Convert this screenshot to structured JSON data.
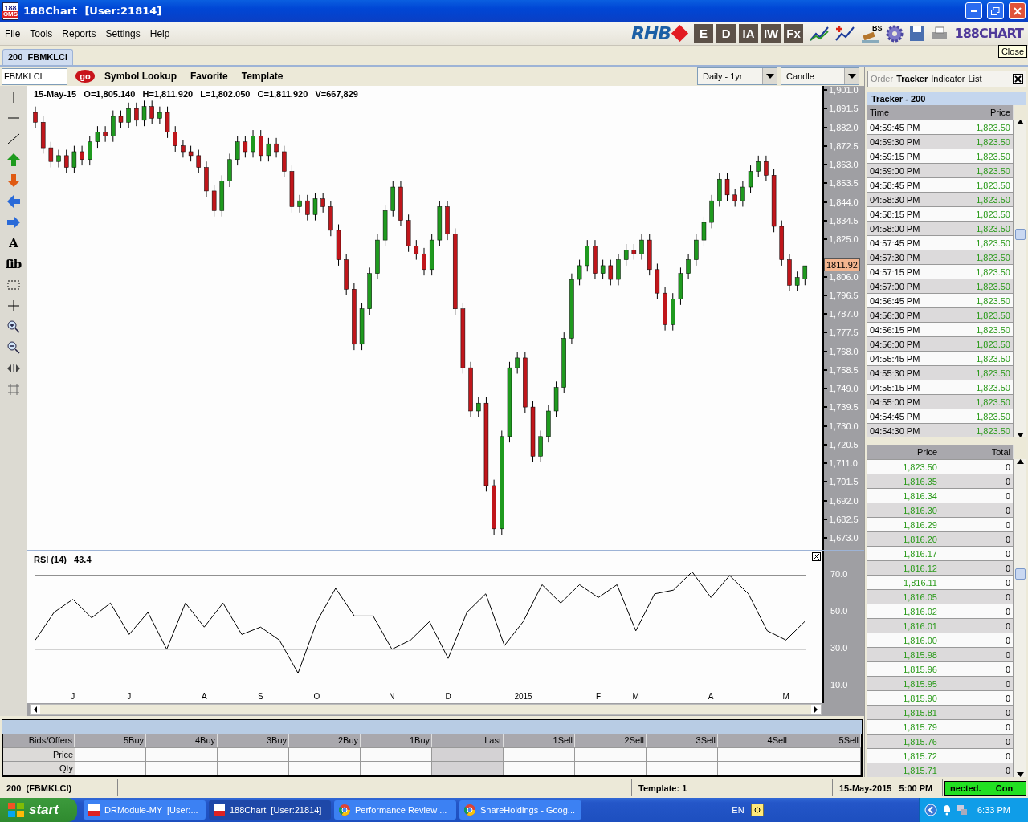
{
  "window": {
    "icon_text": "188",
    "icon_subtext": "OMS",
    "title": "188Chart  [User:21814]"
  },
  "menu": [
    "File",
    "Tools",
    "Reports",
    "Settings",
    "Help"
  ],
  "toolbar": {
    "logo": "RHB",
    "buttons": [
      {
        "label": "E"
      },
      {
        "label": "D"
      },
      {
        "label": "IA"
      },
      {
        "label": "IW"
      },
      {
        "label": "Fx"
      }
    ],
    "gavel_text": "BS",
    "brand": "188CHART",
    "tooltip": "Close"
  },
  "doc_tab": {
    "label": "200  FBMKLCI",
    "selected": true
  },
  "chart_toolbar": {
    "symbol": "FBMKLCI",
    "go": "go",
    "links": [
      "Symbol Lookup",
      "Favorite",
      "Template"
    ],
    "period": "Daily - 1yr",
    "style": "Candle"
  },
  "tools": [
    {
      "kind": "vline"
    },
    {
      "kind": "hline"
    },
    {
      "kind": "trend"
    },
    {
      "kind": "up"
    },
    {
      "kind": "down"
    },
    {
      "kind": "left"
    },
    {
      "kind": "right"
    },
    {
      "kind": "text",
      "label": "A"
    },
    {
      "kind": "text",
      "label": "fib"
    },
    {
      "kind": "select"
    },
    {
      "kind": "cross"
    },
    {
      "kind": "zoomin"
    },
    {
      "kind": "zoomout"
    },
    {
      "kind": "pan"
    },
    {
      "kind": "grid"
    }
  ],
  "chart": {
    "header": "15-May-15   O=1,805.140   H=1,811.920   L=1,802.050   C=1,811.920   V=667,829",
    "last_price_tag": "1811.92",
    "chart_data": {
      "type": "candlestick",
      "ylim": [
        1667.3,
        1903.5
      ],
      "yticks": [
        {
          "value": 1901,
          "label": "1,901.0"
        },
        {
          "value": 1891.5,
          "label": "1,891.5"
        },
        {
          "value": 1882,
          "label": "1,882.0"
        },
        {
          "value": 1872.5,
          "label": "1,872.5"
        },
        {
          "value": 1863,
          "label": "1,863.0"
        },
        {
          "value": 1853.5,
          "label": "1,853.5"
        },
        {
          "value": 1844,
          "label": "1,844.0"
        },
        {
          "value": 1834.5,
          "label": "1,834.5"
        },
        {
          "value": 1825,
          "label": "1,825.0"
        },
        {
          "value": 1806,
          "label": "1,806.0"
        },
        {
          "value": 1796.5,
          "label": "1,796.5"
        },
        {
          "value": 1787,
          "label": "1,787.0"
        },
        {
          "value": 1777.5,
          "label": "1,777.5"
        },
        {
          "value": 1768,
          "label": "1,768.0"
        },
        {
          "value": 1758.5,
          "label": "1,758.5"
        },
        {
          "value": 1749,
          "label": "1,749.0"
        },
        {
          "value": 1739.5,
          "label": "1,739.5"
        },
        {
          "value": 1730,
          "label": "1,730.0"
        },
        {
          "value": 1720.5,
          "label": "1,720.5"
        },
        {
          "value": 1711,
          "label": "1,711.0"
        },
        {
          "value": 1701.5,
          "label": "1,701.5"
        },
        {
          "value": 1692,
          "label": "1,692.0"
        },
        {
          "value": 1682.5,
          "label": "1,682.5"
        },
        {
          "value": 1673,
          "label": "1,673.0"
        }
      ],
      "ohlc": [
        [
          1890,
          1893,
          1882,
          1885
        ],
        [
          1885,
          1888,
          1869,
          1872
        ],
        [
          1872,
          1875,
          1862,
          1865
        ],
        [
          1865,
          1871,
          1862,
          1868
        ],
        [
          1868,
          1871,
          1859,
          1862
        ],
        [
          1862,
          1873,
          1859,
          1870
        ],
        [
          1870,
          1873,
          1863,
          1866
        ],
        [
          1866,
          1878,
          1863,
          1875
        ],
        [
          1875,
          1883,
          1872,
          1880
        ],
        [
          1880,
          1883,
          1875,
          1878
        ],
        [
          1878,
          1891,
          1875,
          1888
        ],
        [
          1888,
          1891,
          1882,
          1885
        ],
        [
          1885,
          1895,
          1882,
          1892
        ],
        [
          1892,
          1895,
          1883,
          1886
        ],
        [
          1886,
          1896,
          1883,
          1893
        ],
        [
          1893,
          1896,
          1884,
          1887
        ],
        [
          1887,
          1893,
          1884,
          1890
        ],
        [
          1890,
          1893,
          1877,
          1880
        ],
        [
          1880,
          1883,
          1870,
          1873
        ],
        [
          1873,
          1876,
          1867,
          1870
        ],
        [
          1870,
          1873,
          1865,
          1868
        ],
        [
          1868,
          1871,
          1859,
          1862
        ],
        [
          1862,
          1865,
          1847,
          1850
        ],
        [
          1850,
          1853,
          1837,
          1840
        ],
        [
          1840,
          1858,
          1837,
          1855
        ],
        [
          1855,
          1869,
          1852,
          1866
        ],
        [
          1866,
          1878,
          1863,
          1875
        ],
        [
          1875,
          1878,
          1867,
          1870
        ],
        [
          1870,
          1881,
          1867,
          1878
        ],
        [
          1878,
          1881,
          1865,
          1868
        ],
        [
          1868,
          1877,
          1865,
          1874
        ],
        [
          1874,
          1877,
          1867,
          1870
        ],
        [
          1870,
          1873,
          1857,
          1860
        ],
        [
          1860,
          1863,
          1839,
          1842
        ],
        [
          1842,
          1848,
          1839,
          1845
        ],
        [
          1845,
          1848,
          1835,
          1838
        ],
        [
          1838,
          1849,
          1835,
          1846
        ],
        [
          1846,
          1849,
          1839,
          1842
        ],
        [
          1842,
          1845,
          1827,
          1830
        ],
        [
          1830,
          1833,
          1812,
          1815
        ],
        [
          1815,
          1818,
          1797,
          1800
        ],
        [
          1800,
          1803,
          1769,
          1772
        ],
        [
          1772,
          1793,
          1769,
          1790
        ],
        [
          1790,
          1811,
          1787,
          1808
        ],
        [
          1808,
          1828,
          1805,
          1825
        ],
        [
          1825,
          1843,
          1822,
          1840
        ],
        [
          1840,
          1855,
          1837,
          1852
        ],
        [
          1852,
          1855,
          1832,
          1835
        ],
        [
          1835,
          1838,
          1819,
          1822
        ],
        [
          1822,
          1825,
          1815,
          1818
        ],
        [
          1818,
          1821,
          1807,
          1810
        ],
        [
          1810,
          1828,
          1807,
          1825
        ],
        [
          1825,
          1845,
          1822,
          1842
        ],
        [
          1842,
          1845,
          1825,
          1828
        ],
        [
          1828,
          1831,
          1787,
          1790
        ],
        [
          1790,
          1793,
          1757,
          1760
        ],
        [
          1760,
          1763,
          1735,
          1738
        ],
        [
          1738,
          1745,
          1735,
          1742
        ],
        [
          1742,
          1745,
          1697,
          1700
        ],
        [
          1700,
          1703,
          1675,
          1678
        ],
        [
          1678,
          1728,
          1675,
          1725
        ],
        [
          1725,
          1763,
          1722,
          1760
        ],
        [
          1760,
          1768,
          1757,
          1765
        ],
        [
          1765,
          1768,
          1737,
          1740
        ],
        [
          1740,
          1743,
          1712,
          1715
        ],
        [
          1715,
          1728,
          1712,
          1725
        ],
        [
          1725,
          1741,
          1722,
          1738
        ],
        [
          1738,
          1753,
          1735,
          1750
        ],
        [
          1750,
          1778,
          1747,
          1775
        ],
        [
          1775,
          1808,
          1772,
          1805
        ],
        [
          1805,
          1815,
          1802,
          1812
        ],
        [
          1812,
          1825,
          1809,
          1822
        ],
        [
          1822,
          1825,
          1805,
          1808
        ],
        [
          1808,
          1815,
          1805,
          1812
        ],
        [
          1812,
          1815,
          1802,
          1805
        ],
        [
          1805,
          1818,
          1802,
          1815
        ],
        [
          1815,
          1823,
          1812,
          1820
        ],
        [
          1820,
          1823,
          1815,
          1818
        ],
        [
          1818,
          1828,
          1815,
          1825
        ],
        [
          1825,
          1828,
          1807,
          1810
        ],
        [
          1810,
          1813,
          1795,
          1798
        ],
        [
          1798,
          1801,
          1779,
          1782
        ],
        [
          1782,
          1798,
          1779,
          1795
        ],
        [
          1795,
          1811,
          1792,
          1808
        ],
        [
          1808,
          1818,
          1805,
          1815
        ],
        [
          1815,
          1828,
          1812,
          1825
        ],
        [
          1825,
          1837,
          1822,
          1834
        ],
        [
          1834,
          1848,
          1831,
          1845
        ],
        [
          1845,
          1859,
          1842,
          1856
        ],
        [
          1856,
          1859,
          1845,
          1848
        ],
        [
          1848,
          1851,
          1842,
          1845
        ],
        [
          1845,
          1855,
          1842,
          1852
        ],
        [
          1852,
          1863,
          1849,
          1860
        ],
        [
          1860,
          1868,
          1857,
          1865
        ],
        [
          1865,
          1868,
          1855,
          1858
        ],
        [
          1858,
          1861,
          1829,
          1832
        ],
        [
          1832,
          1835,
          1812,
          1815
        ],
        [
          1815,
          1818,
          1799,
          1802
        ],
        [
          1802,
          1809,
          1799,
          1806
        ],
        [
          1805.14,
          1811.92,
          1802.05,
          1811.92
        ]
      ]
    },
    "rsi": {
      "header": "RSI (14)   43.4",
      "chart_data": {
        "type": "line",
        "yticks": [
          {
            "value": 70,
            "label": "70.0"
          },
          {
            "value": 50,
            "label": "50.0"
          },
          {
            "value": 30,
            "label": "30.0"
          },
          {
            "value": 10,
            "label": "10.0"
          }
        ],
        "ylim": [
          9,
          83
        ],
        "categories": [
          null,
          null,
          "J",
          null,
          null,
          "J",
          null,
          null,
          null,
          "A",
          null,
          null,
          "S",
          null,
          null,
          "O",
          null,
          null,
          null,
          "N",
          null,
          null,
          "D",
          null,
          null,
          null,
          "2015",
          null,
          null,
          null,
          "F",
          null,
          "M",
          null,
          null,
          null,
          "A",
          null,
          null,
          null,
          "M",
          null
        ],
        "series": [
          {
            "color": "#000000",
            "values": [
              35,
              50,
              57,
              47,
              55,
              38,
              50,
              30,
              55,
              42,
              55,
              38,
              42,
              35,
              17,
              45,
              63,
              48,
              48,
              30,
              35,
              45,
              25,
              50,
              60,
              32,
              45,
              65,
              55,
              65,
              58,
              65,
              40,
              60,
              62,
              72,
              58,
              70,
              60,
              40,
              35,
              45
            ]
          }
        ]
      }
    },
    "kind": "stock"
  },
  "depth": {
    "columns": [
      "Bids/Offers",
      "5Buy",
      "4Buy",
      "3Buy",
      "2Buy",
      "1Buy",
      "Last",
      "1Sell",
      "2Sell",
      "3Sell",
      "4Sell",
      "5Sell"
    ],
    "rows": [
      "Price",
      "Qty"
    ]
  },
  "side": {
    "tabs": [
      {
        "label": "Order",
        "selected": false,
        "disabled": true
      },
      {
        "label": "Tracker",
        "selected": true,
        "disabled": false
      },
      {
        "label": "Indicator",
        "selected": false,
        "disabled": false
      },
      {
        "label": "List",
        "selected": false,
        "disabled": false
      }
    ],
    "tracker_title": "Tracker - 200",
    "tracker_columns": [
      "Time",
      "Price"
    ],
    "tracker_rows": [
      [
        "04:59:45 PM",
        "1,823.50"
      ],
      [
        "04:59:30 PM",
        "1,823.50"
      ],
      [
        "04:59:15 PM",
        "1,823.50"
      ],
      [
        "04:59:00 PM",
        "1,823.50"
      ],
      [
        "04:58:45 PM",
        "1,823.50"
      ],
      [
        "04:58:30 PM",
        "1,823.50"
      ],
      [
        "04:58:15 PM",
        "1,823.50"
      ],
      [
        "04:58:00 PM",
        "1,823.50"
      ],
      [
        "04:57:45 PM",
        "1,823.50"
      ],
      [
        "04:57:30 PM",
        "1,823.50"
      ],
      [
        "04:57:15 PM",
        "1,823.50"
      ],
      [
        "04:57:00 PM",
        "1,823.50"
      ],
      [
        "04:56:45 PM",
        "1,823.50"
      ],
      [
        "04:56:30 PM",
        "1,823.50"
      ],
      [
        "04:56:15 PM",
        "1,823.50"
      ],
      [
        "04:56:00 PM",
        "1,823.50"
      ],
      [
        "04:55:45 PM",
        "1,823.50"
      ],
      [
        "04:55:30 PM",
        "1,823.50"
      ],
      [
        "04:55:15 PM",
        "1,823.50"
      ],
      [
        "04:55:00 PM",
        "1,823.50"
      ],
      [
        "04:54:45 PM",
        "1,823.50"
      ],
      [
        "04:54:30 PM",
        "1,823.50"
      ]
    ],
    "volume_columns": [
      "Price",
      "Total"
    ],
    "volume_rows": [
      [
        "1,823.50",
        "0"
      ],
      [
        "1,816.35",
        "0"
      ],
      [
        "1,816.34",
        "0"
      ],
      [
        "1,816.30",
        "0"
      ],
      [
        "1,816.29",
        "0"
      ],
      [
        "1,816.20",
        "0"
      ],
      [
        "1,816.17",
        "0"
      ],
      [
        "1,816.12",
        "0"
      ],
      [
        "1,816.11",
        "0"
      ],
      [
        "1,816.05",
        "0"
      ],
      [
        "1,816.02",
        "0"
      ],
      [
        "1,816.01",
        "0"
      ],
      [
        "1,816.00",
        "0"
      ],
      [
        "1,815.98",
        "0"
      ],
      [
        "1,815.96",
        "0"
      ],
      [
        "1,815.95",
        "0"
      ],
      [
        "1,815.90",
        "0"
      ],
      [
        "1,815.81",
        "0"
      ],
      [
        "1,815.79",
        "0"
      ],
      [
        "1,815.76",
        "0"
      ],
      [
        "1,815.72",
        "0"
      ],
      [
        "1,815.71",
        "0"
      ]
    ]
  },
  "status_bar": {
    "symbol": "200  (FBMKLCI)",
    "template": "Template: 1",
    "datetime": "15-May-2015   5:00 PM",
    "connection": "nected.      Con"
  },
  "taskbar": {
    "start": "start",
    "items": [
      {
        "label": "DRModule-MY  [User:...",
        "kind": "oms",
        "selected": false
      },
      {
        "label": "188Chart  [User:21814]",
        "kind": "oms",
        "selected": true
      },
      {
        "label": "Performance Review ...",
        "kind": "browser",
        "selected": false
      },
      {
        "label": "ShareHoldings - Goog...",
        "kind": "browser",
        "selected": false
      }
    ],
    "language": "EN",
    "clock": "6:33 PM"
  }
}
